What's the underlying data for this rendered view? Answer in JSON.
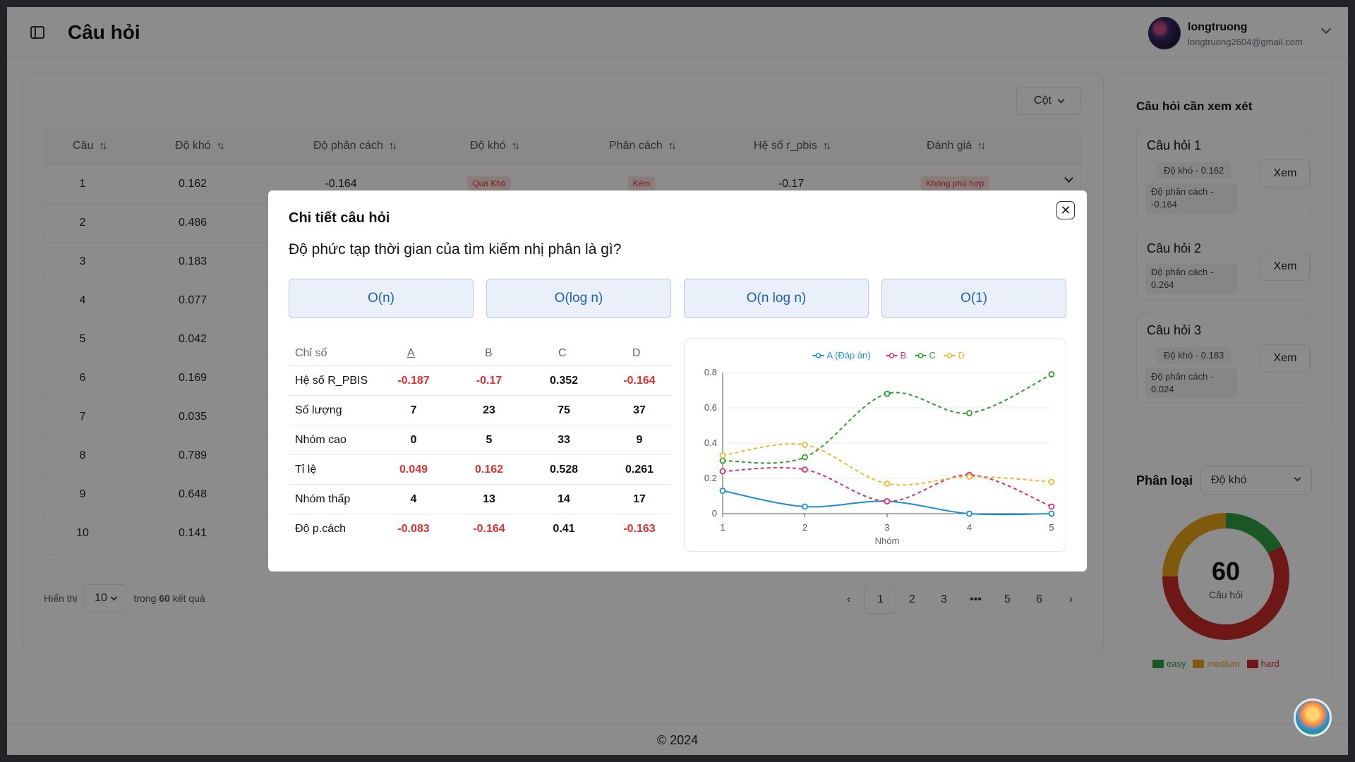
{
  "header": {
    "title": "Câu hỏi",
    "user_name": "longtruong",
    "user_email": "longtruong2604@gmail.com"
  },
  "toolbar": {
    "columns_label": "Cột"
  },
  "table": {
    "headers": [
      "Câu",
      "Độ khó",
      "Độ phân cách",
      "Độ khó",
      "Phân cách",
      "Hệ số r_pbis",
      "Đánh giá"
    ],
    "rows": [
      {
        "q": "1",
        "difficulty": "0.162",
        "discrimination": "-0.164",
        "level": "Quá Khó",
        "disc_level": "Kém",
        "rpbis": "-0.17",
        "rating": "Không phù hợp"
      },
      {
        "q": "2",
        "difficulty": "0.486"
      },
      {
        "q": "3",
        "difficulty": "0.183"
      },
      {
        "q": "4",
        "difficulty": "0.077"
      },
      {
        "q": "5",
        "difficulty": "0.042"
      },
      {
        "q": "6",
        "difficulty": "0.169"
      },
      {
        "q": "7",
        "difficulty": "0.035"
      },
      {
        "q": "8",
        "difficulty": "0.789"
      },
      {
        "q": "9",
        "difficulty": "0.648"
      },
      {
        "q": "10",
        "difficulty": "0.141"
      }
    ]
  },
  "pagination": {
    "show_label": "Hiển thị",
    "page_size": "10",
    "summary_prefix": "trong",
    "total": "60",
    "summary_suffix": "kết quả",
    "pages": [
      "1",
      "2",
      "3",
      "•••",
      "5",
      "6"
    ],
    "current": "1"
  },
  "review": {
    "title": "Câu hỏi cần xem xét",
    "button_label": "Xem",
    "items": [
      {
        "name": "Câu hỏi 1",
        "badge": "Độ khó - 0.162",
        "note": "Độ phân cách - -0.164"
      },
      {
        "name": "Câu hỏi 2",
        "badge": "",
        "note": "Độ phân cách - 0.264"
      },
      {
        "name": "Câu hỏi 3",
        "badge": "Độ khó - 0.183",
        "note": "Độ phân cách - 0.024"
      }
    ]
  },
  "classification": {
    "title": "Phân loại",
    "select_value": "Độ khó",
    "total": "60",
    "total_label": "Câu hỏi",
    "legend": [
      {
        "label": "easy",
        "color": "#2f9e44"
      },
      {
        "label": "medium",
        "color": "#e8a317"
      },
      {
        "label": "hard",
        "color": "#c92a2a"
      }
    ],
    "donut_shares": {
      "easy": 0.17,
      "medium": 0.25,
      "hard": 0.58
    }
  },
  "footer": {
    "text": "© 2024"
  },
  "modal": {
    "title": "Chi tiết câu hỏi",
    "question": "Độ phức tạp thời gian của tìm kiếm nhị phân là gì?",
    "options": [
      "O(n)",
      "O(log n)",
      "O(n log n)",
      "O(1)"
    ],
    "stats_header": [
      "Chỉ số",
      "A",
      "B",
      "C",
      "D"
    ],
    "stats": [
      {
        "label": "Hệ số R_PBIS",
        "values": [
          "-0.187",
          "-0.17",
          "0.352",
          "-0.164"
        ]
      },
      {
        "label": "Số lượng",
        "values": [
          "7",
          "23",
          "75",
          "37"
        ]
      },
      {
        "label": "Nhóm cao",
        "values": [
          "0",
          "5",
          "33",
          "9"
        ]
      },
      {
        "label": "Tỉ lệ",
        "values": [
          "0.049",
          "0.162",
          "0.528",
          "0.261"
        ]
      },
      {
        "label": "Nhóm thấp",
        "values": [
          "4",
          "13",
          "14",
          "17"
        ]
      },
      {
        "label": "Độ p.cách",
        "values": [
          "-0.083",
          "-0.164",
          "0.41",
          "-0.163"
        ]
      }
    ],
    "colors": {
      "negative": "#e03131",
      "option_bg": "#e9f0fa",
      "option_text": "#1f5fb8"
    }
  },
  "chart_data": {
    "type": "line",
    "title": "",
    "xlabel": "Nhóm",
    "ylabel": "",
    "x": [
      1,
      2,
      3,
      4,
      5
    ],
    "ylim": [
      0,
      0.8
    ],
    "yticks": [
      "0",
      "0.2",
      "0.4",
      "0.6",
      "0.8"
    ],
    "grid": true,
    "legend_position": "top",
    "series": [
      {
        "name": "A (Đáp án)",
        "color": "#1c8ed6",
        "dashed": false,
        "values": [
          0.13,
          0.04,
          0.07,
          0.0,
          0.0
        ]
      },
      {
        "name": "B",
        "color": "#d6336c",
        "dashed": true,
        "values": [
          0.24,
          0.25,
          0.07,
          0.22,
          0.04
        ]
      },
      {
        "name": "C",
        "color": "#2b9e2b",
        "dashed": true,
        "values": [
          0.3,
          0.32,
          0.68,
          0.57,
          0.79
        ]
      },
      {
        "name": "D",
        "color": "#e8b930",
        "dashed": true,
        "values": [
          0.33,
          0.39,
          0.17,
          0.21,
          0.18
        ]
      }
    ]
  }
}
